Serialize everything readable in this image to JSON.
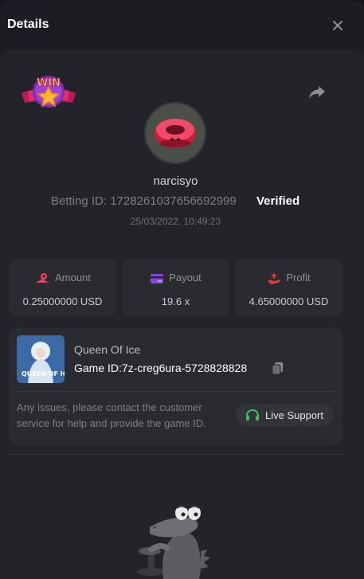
{
  "header": {
    "title": "Details"
  },
  "bet": {
    "username": "narcisyo",
    "betting_id_label": "Betting ID:",
    "betting_id": "1728261037656692999",
    "verified": "Verified",
    "timestamp": "25/03/2022, 10:49:23",
    "badge_text": "WIN"
  },
  "stats": [
    {
      "label": "Amount",
      "value": "0.25000000 USD",
      "icon": "amount-icon",
      "color": "#e8405c"
    },
    {
      "label": "Payout",
      "value": "19.6 x",
      "icon": "payout-icon",
      "color": "#8a45e0"
    },
    {
      "label": "Profit",
      "value": "4.65000000 USD",
      "icon": "profit-icon",
      "color": "#e23b3b"
    }
  ],
  "game": {
    "name": "Queen Of Ice",
    "thumb_text": "QUEEN OF ICE",
    "game_id_label": "Game ID:",
    "game_id": "7z-creg6ura-5728828828"
  },
  "support": {
    "help_text": "Any issues, please contact the customer service for help and provide the game ID.",
    "button_label": "Live Support"
  },
  "colors": {
    "accent_green": "#3bc25a",
    "background": "#1c1d22",
    "panel": "#23242a",
    "card": "#2a2b31"
  }
}
